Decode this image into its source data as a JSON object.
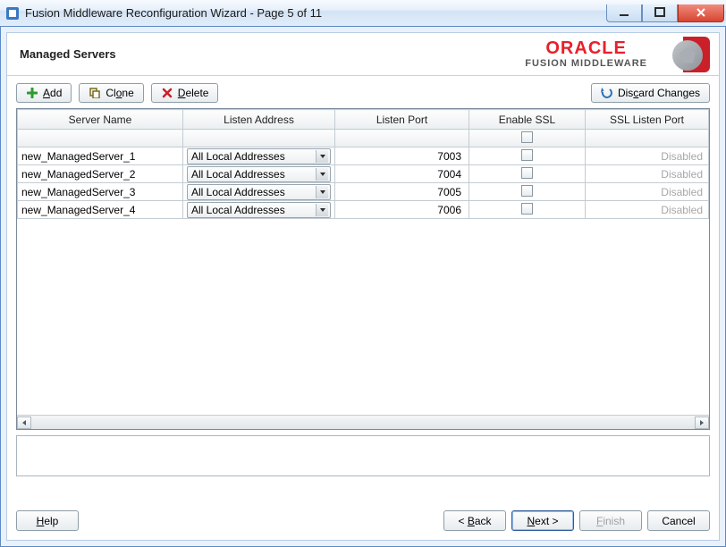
{
  "window": {
    "title": "Fusion Middleware Reconfiguration Wizard - Page 5 of 11"
  },
  "header": {
    "page_title": "Managed Servers",
    "brand_word": "ORACLE",
    "brand_sub": "FUSION MIDDLEWARE"
  },
  "toolbar": {
    "add": "Add",
    "clone": "Clone",
    "delete": "Delete",
    "discard": "Discard Changes"
  },
  "table": {
    "columns": {
      "server_name": "Server Name",
      "listen_address": "Listen Address",
      "listen_port": "Listen Port",
      "enable_ssl": "Enable SSL",
      "ssl_listen_port": "SSL Listen Port"
    },
    "listen_address_option": "All Local Addresses",
    "rows": [
      {
        "name": "new_ManagedServer_1",
        "port": "7003",
        "ssl": false,
        "ssl_port": "Disabled"
      },
      {
        "name": "new_ManagedServer_2",
        "port": "7004",
        "ssl": false,
        "ssl_port": "Disabled"
      },
      {
        "name": "new_ManagedServer_3",
        "port": "7005",
        "ssl": false,
        "ssl_port": "Disabled"
      },
      {
        "name": "new_ManagedServer_4",
        "port": "7006",
        "ssl": false,
        "ssl_port": "Disabled"
      }
    ]
  },
  "footer": {
    "help": "Help",
    "back": "Back",
    "next": "Next",
    "finish": "Finish",
    "cancel": "Cancel"
  }
}
